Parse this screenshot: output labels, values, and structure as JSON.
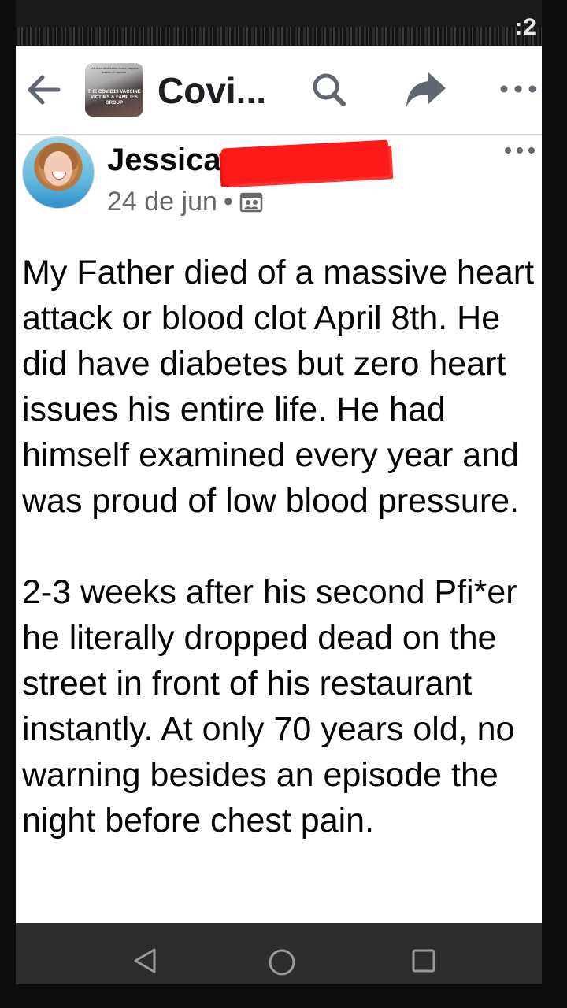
{
  "status_bar": {
    "time_fragment": ":2"
  },
  "header": {
    "title": "Covi...",
    "group_avatar_caption": "THE COVID19 VACCINE VICTIMS & FAMILIES GROUP",
    "group_avatar_small_text": "Ask how died within hours, days or weeks of vaccine"
  },
  "post": {
    "author": "Jessica",
    "date": "24 de jun",
    "meta_separator": "•",
    "paragraphs": [
      "My Father died of a massive heart attack or blood clot April 8th. He did have diabetes but zero heart issues his entire life. He had himself examined every year and was proud of low blood pressure.",
      "2-3 weeks after his second Pfi*er he literally dropped dead on the street in front of his restaurant instantly. At only 70 years old, no warning besides an episode the night before chest pain."
    ]
  },
  "colors": {
    "redaction": "#ff1a1a",
    "text_primary": "#050505",
    "text_secondary": "#65676b",
    "navbar": "#2d2d2d"
  },
  "icons": {
    "back": "arrow-left-icon",
    "search": "search-icon",
    "share": "share-arrow-icon",
    "more": "more-horizontal-icon",
    "audience": "group-audience-icon",
    "nav_back": "nav-back-triangle-icon",
    "nav_home": "nav-home-circle-icon",
    "nav_recent": "nav-recent-square-icon"
  }
}
